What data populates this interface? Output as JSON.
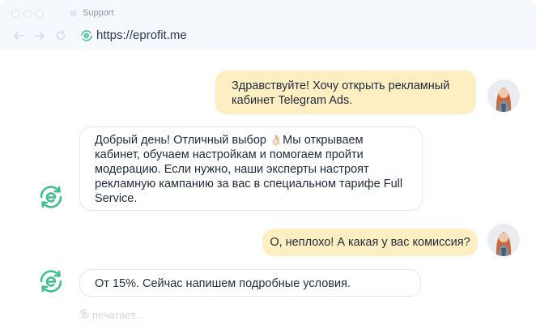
{
  "browser": {
    "tab_title": "Support",
    "url": "https://eprofit.me"
  },
  "chat": {
    "messages": [
      {
        "from": "user",
        "text": "Здравствуйте! Хочу открыть рекламный кабинет Telegram Ads."
      },
      {
        "from": "bot",
        "text_before_emoji": "Добрый день! Отличный выбор ",
        "emoji": "👌🏻",
        "text_after_emoji": "Мы открываем кабинет, обучаем настройкам и помогаем пройти модерацию. Если нужно, наши эксперты настроят рекламную кампанию за вас в специальном тарифе Full Service."
      },
      {
        "from": "user",
        "text": "О, неплохо! А какая у вас комиссия?"
      },
      {
        "from": "bot",
        "text": "От 15%. Сейчас напишем подробные условия."
      }
    ],
    "typing_indicator": "печатает..."
  },
  "colors": {
    "brand_green": "#3fbf8f",
    "user_bubble": "#fdefc2",
    "bot_bubble_border": "#e3e7ee",
    "chrome_bg": "#f5f8fc"
  },
  "icons": {
    "brand": "eprofit-logo-icon",
    "back": "arrow-left-icon",
    "forward": "arrow-right-icon",
    "reload": "reload-icon"
  }
}
